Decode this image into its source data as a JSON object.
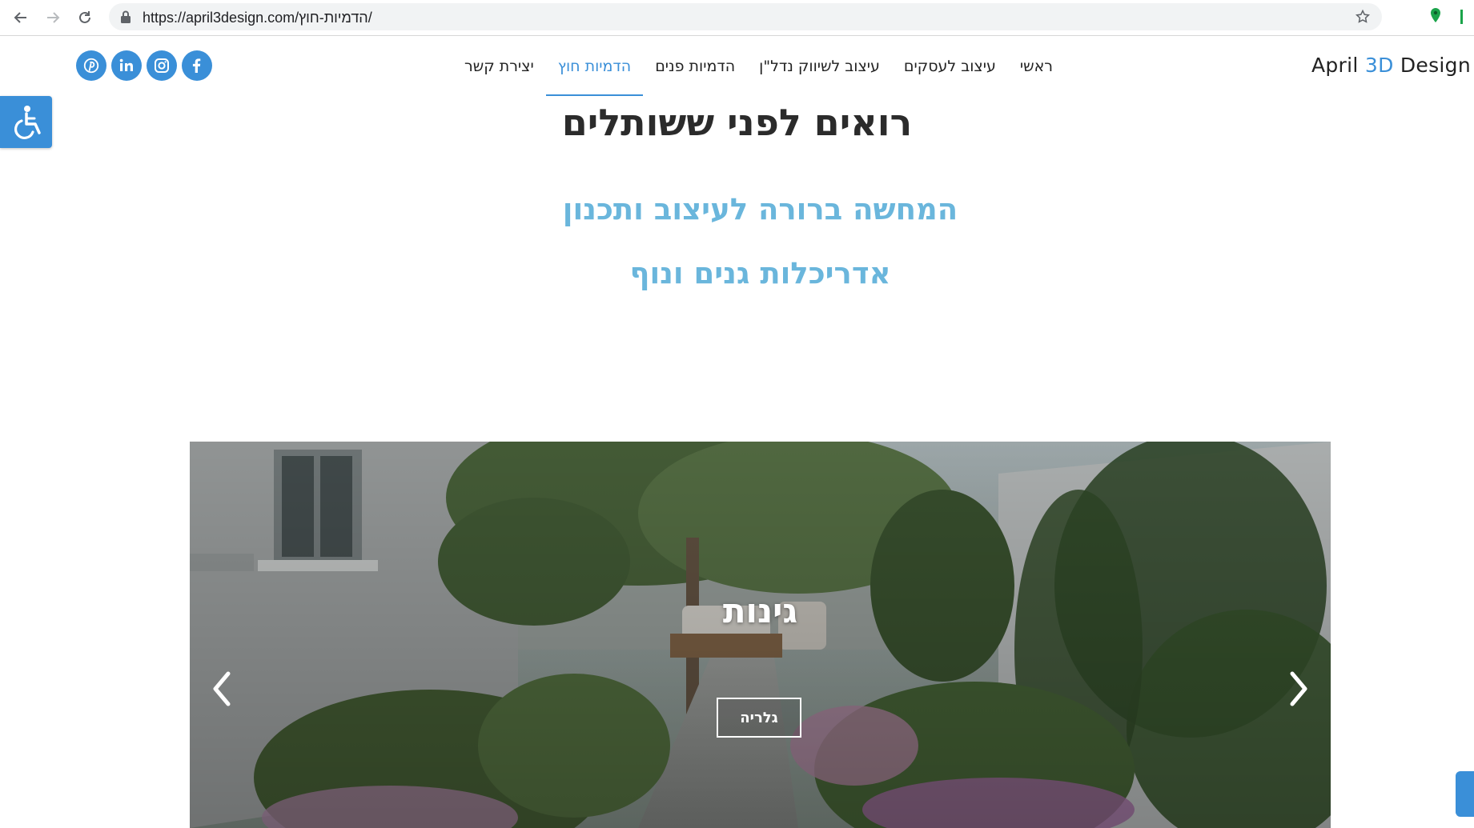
{
  "browser": {
    "url": "https://april3design.com/הדמיות-חוץ/"
  },
  "header": {
    "logo": {
      "part1": "April ",
      "accent": "3D",
      "part2": " Design"
    },
    "nav": [
      {
        "label": "ראשי",
        "active": false
      },
      {
        "label": "עיצוב לעסקים",
        "active": false
      },
      {
        "label": "עיצוב לשיווק נדל\"ן",
        "active": false
      },
      {
        "label": "הדמיות פנים",
        "active": false
      },
      {
        "label": "הדמיות חוץ",
        "active": true
      },
      {
        "label": "יצירת קשר",
        "active": false
      }
    ],
    "socials": [
      "pinterest-icon",
      "linkedin-icon",
      "instagram-icon",
      "facebook-icon"
    ],
    "accent_color": "#3a8fd8"
  },
  "hero": {
    "headline": "רואים לפני ששותלים",
    "subline1": "המחשה ברורה לעיצוב ותכנון",
    "subline2": "אדריכלות גנים ונוף"
  },
  "slider": {
    "title": "גינות",
    "button_label": "גלריה"
  },
  "colors": {
    "subtitle": "#6ab6dc",
    "headline": "#2b2b2b"
  }
}
